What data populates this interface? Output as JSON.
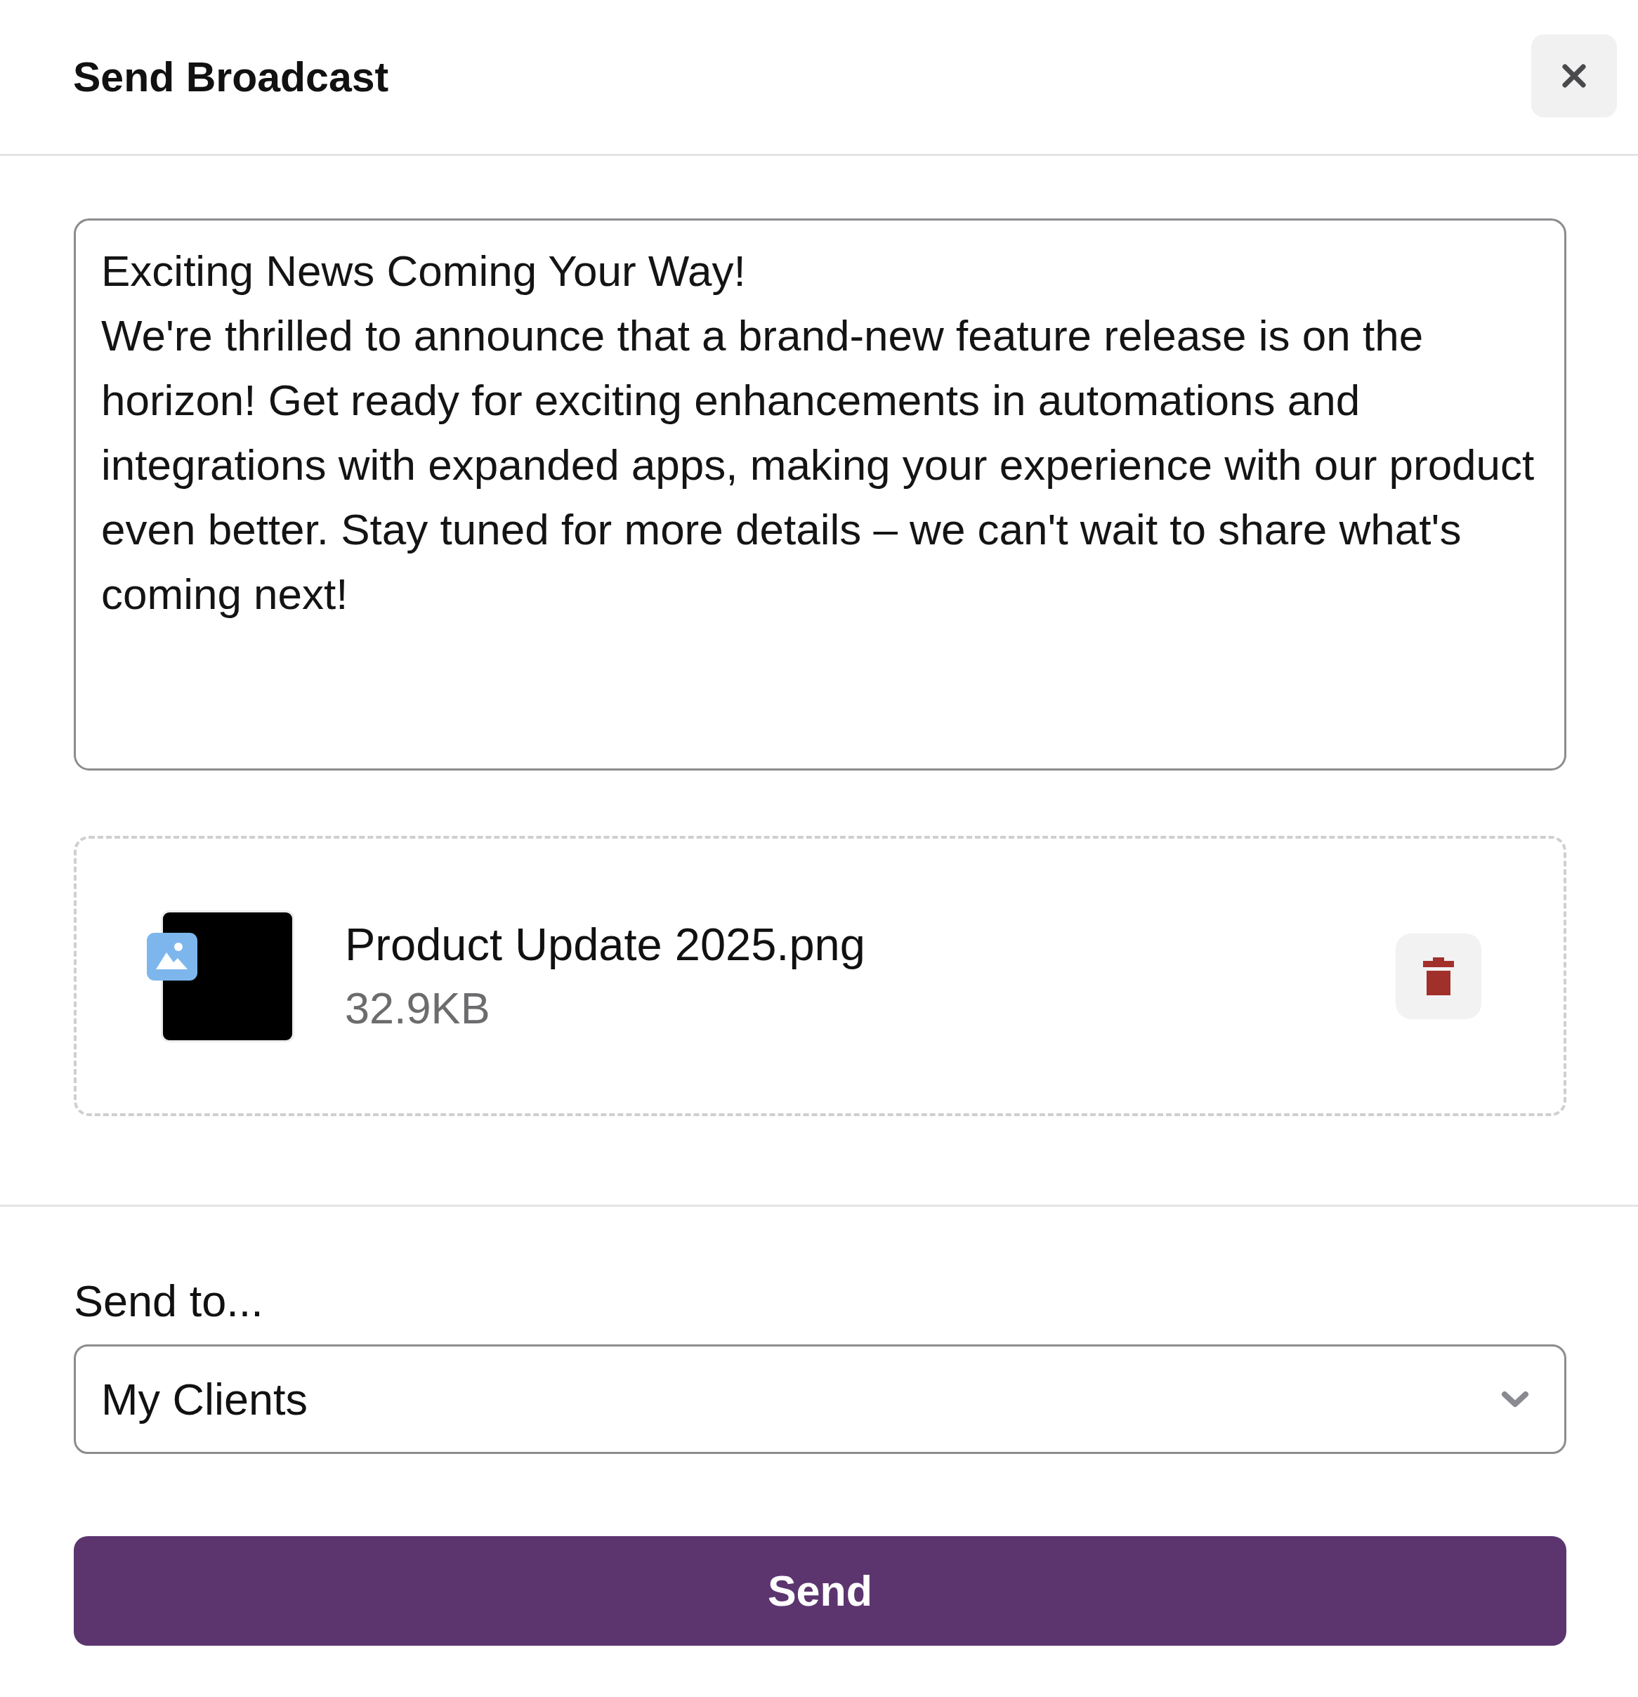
{
  "dialog": {
    "title": "Send Broadcast"
  },
  "message": {
    "value": "Exciting News Coming Your Way!\nWe're thrilled to announce that a brand-new feature release is on the horizon! Get ready for exciting enhancements in automations and integrations with expanded apps, making your experience with our product even better. Stay tuned for more details – we can't wait to share what's coming next!"
  },
  "attachment": {
    "file_name": "Product Update 2025.png",
    "file_size": "32.9KB"
  },
  "recipients": {
    "label": "Send to...",
    "value": "My Clients"
  },
  "send_button": {
    "label": "Send"
  }
}
